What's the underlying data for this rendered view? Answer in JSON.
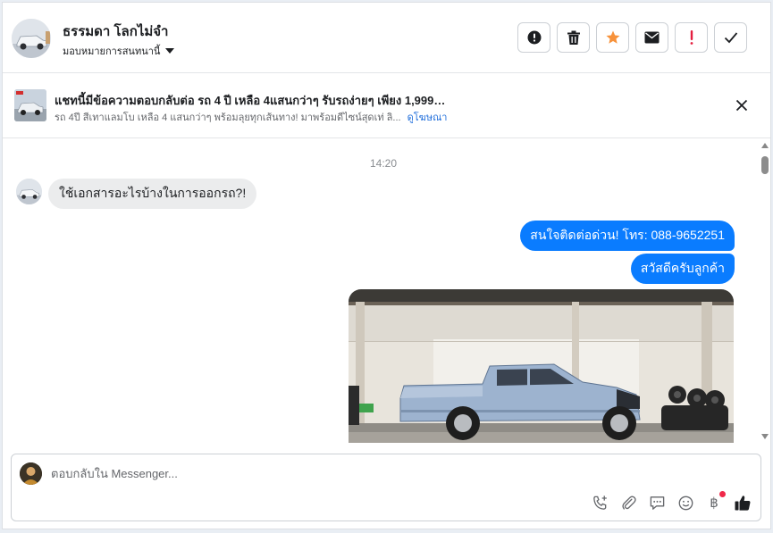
{
  "header": {
    "user_name": "ธรรมดา โลกไม่จำ",
    "assign_label": "มอบหมายการสนทนานี้",
    "actions": [
      "spam-icon",
      "trash-icon",
      "star-icon",
      "mail-icon",
      "exclamation-icon",
      "check-icon"
    ]
  },
  "ad": {
    "title": "แชทนี้มีข้อความตอบกลับต่อ รถ 4 ปี เหลือ 4แสนกว่าๆ รับรถง่ายๆ เพียง 1,999 บ...",
    "subtitle": "รถ 4ปี สีเทาแลมโบ เหลือ 4 แสนกว่าๆ พร้อมลุยทุกเส้นทาง! มาพร้อมดีไซน์สุดเท่ ลิ...",
    "link": "ดูโฆษณา"
  },
  "conversation": {
    "timestamp": "14:20",
    "incoming": "ใช้เอกสารอะไรบ้างในการออกรถ?!",
    "outgoing": [
      "สนใจติดต่อด่วน! โทร: 088-9652251",
      "สวัสดีครับลูกค้า"
    ]
  },
  "composer": {
    "placeholder": "ตอบกลับใน Messenger...",
    "baht_symbol": "฿"
  },
  "colors": {
    "accent": "#0a7cff",
    "star": "#f7923b",
    "alert": "#e41e3f"
  }
}
